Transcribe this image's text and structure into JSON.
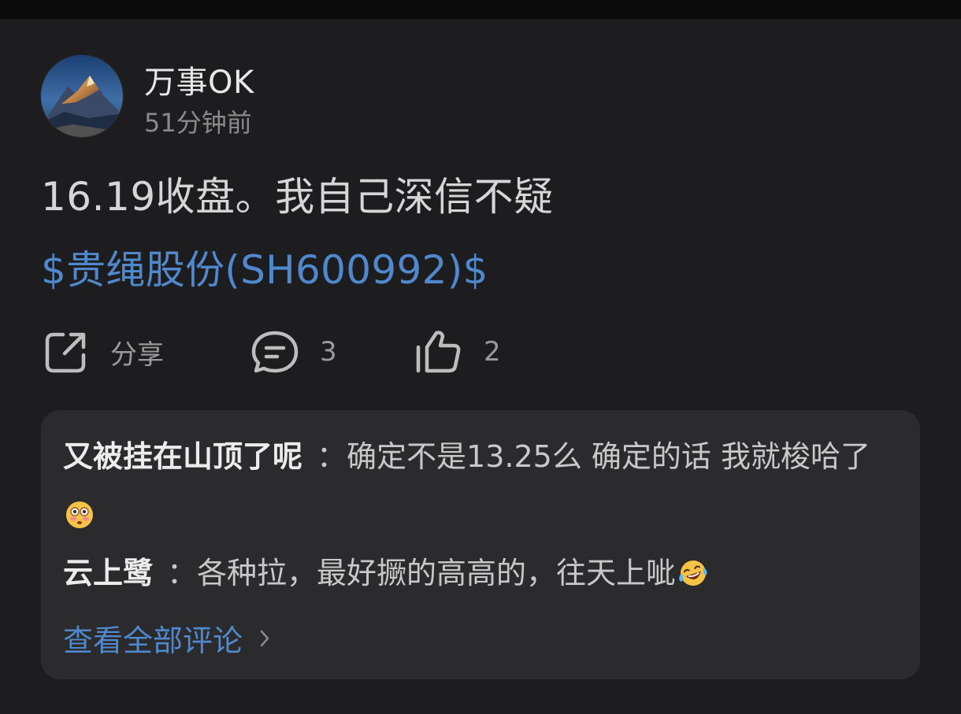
{
  "post": {
    "author": "万事OK",
    "time": "51分钟前",
    "text": "16.19收盘。我自己深信不疑",
    "stock_tag": "$贵绳股份(SH600992)$"
  },
  "actions": {
    "share_label": "分享",
    "comment_count": "3",
    "like_count": "2"
  },
  "comments": [
    {
      "user": "又被挂在山顶了呢",
      "separator": "：",
      "text": "确定不是13.25么 确定的话 我就梭哈了",
      "emoji": "flushed-face-emoji"
    },
    {
      "user": "云上鹭",
      "separator": "：",
      "text": "各种拉，最好撅的高高的，往天上呲",
      "emoji": "laughing-crying-face-emoji"
    }
  ],
  "view_all_comments": "查看全部评论",
  "colors": {
    "background": "#1d1d1f",
    "comment_box": "#2b2b2d",
    "link_blue": "#4f88cc",
    "muted_text": "#8a8a8a"
  }
}
